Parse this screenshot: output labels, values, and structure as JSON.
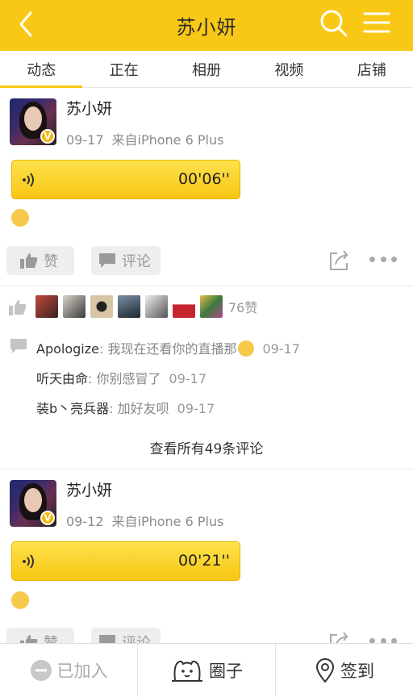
{
  "header": {
    "title": "苏小妍"
  },
  "tabs": [
    "动态",
    "正在",
    "相册",
    "视频",
    "店铺"
  ],
  "posts": [
    {
      "author": "苏小妍",
      "date": "09-17",
      "source": "来自iPhone 6 Plus",
      "voice_duration": "00'06''",
      "like_label": "赞",
      "comment_label": "评论",
      "likes_count": "76赞",
      "comments": [
        {
          "who": "Apologize",
          "text": "我现在还看你的直播那",
          "time": "09-17"
        },
        {
          "who": "听天由命",
          "text": "你别感冒了",
          "time": "09-17"
        },
        {
          "who": "装b丶亮兵器",
          "text": "加好友呗",
          "time": "09-17"
        }
      ],
      "view_all": "查看所有49条评论"
    },
    {
      "author": "苏小妍",
      "date": "09-12",
      "source": "来自iPhone 6 Plus",
      "voice_duration": "00'21''",
      "like_label": "赞",
      "comment_label": "评论"
    }
  ],
  "bottombar": {
    "joined": "已加入",
    "circle": "圈子",
    "checkin": "签到"
  },
  "colors": {
    "accent": "#f9c816"
  }
}
